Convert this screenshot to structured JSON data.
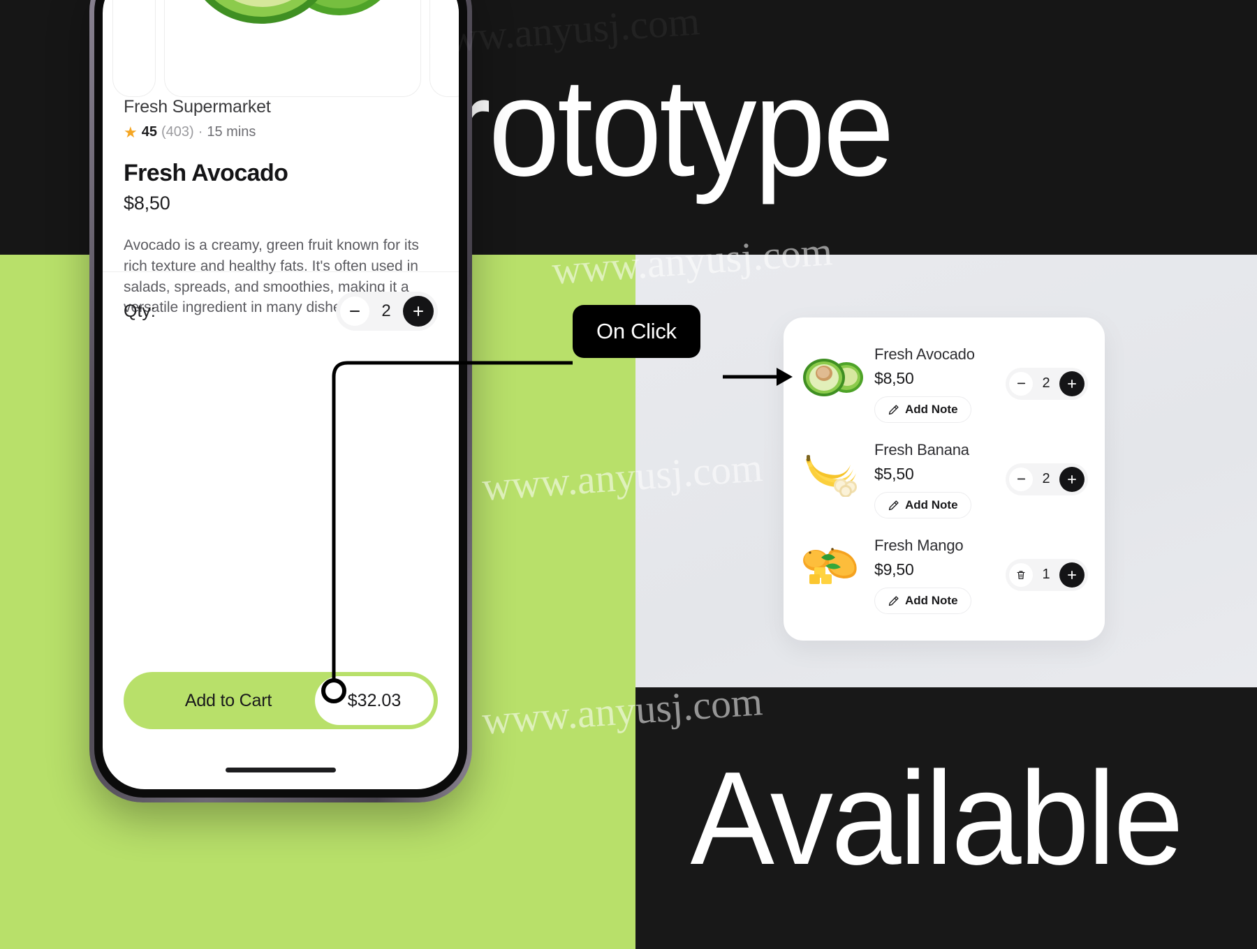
{
  "banner": {
    "top_title": "Prototype",
    "bottom_title": "Available"
  },
  "watermark": {
    "text": "www.anyusj.com"
  },
  "connector": {
    "label": "On Click"
  },
  "phone": {
    "store": {
      "name": "Fresh Supermarket",
      "rating": "45",
      "reviews": "(403)",
      "separator": "·",
      "delivery_time": "15 mins",
      "star_icon": "star-icon"
    },
    "product": {
      "title": "Fresh Avocado",
      "price": "$8,50",
      "description": "Avocado is a creamy, green fruit known for its rich texture and healthy fats. It's often used in salads, spreads, and smoothies, making it a versatile ingredient in many dishes."
    },
    "qty": {
      "label": "Qty:",
      "value": "2",
      "minus_icon": "minus-icon",
      "plus_icon": "plus-icon"
    },
    "cta": {
      "label": "Add to Cart",
      "total": "$32.03"
    }
  },
  "cart": {
    "items": [
      {
        "name": "Fresh Avocado",
        "price": "$8,50",
        "note_label": "Add Note",
        "note_icon": "pencil-icon",
        "qty": "2",
        "left_control": "minus-icon",
        "right_control": "plus-icon",
        "thumb": "avocado-image"
      },
      {
        "name": "Fresh Banana",
        "price": "$5,50",
        "note_label": "Add Note",
        "note_icon": "pencil-icon",
        "qty": "2",
        "left_control": "minus-icon",
        "right_control": "plus-icon",
        "thumb": "banana-image"
      },
      {
        "name": "Fresh Mango",
        "price": "$9,50",
        "note_label": "Add Note",
        "note_icon": "pencil-icon",
        "qty": "1",
        "left_control": "trash-icon",
        "right_control": "plus-icon",
        "thumb": "mango-image"
      }
    ]
  },
  "colors": {
    "accent_green": "#b8e06a",
    "dark": "#161616",
    "star": "#f5a623",
    "panel_gray": "#e9eaee"
  }
}
